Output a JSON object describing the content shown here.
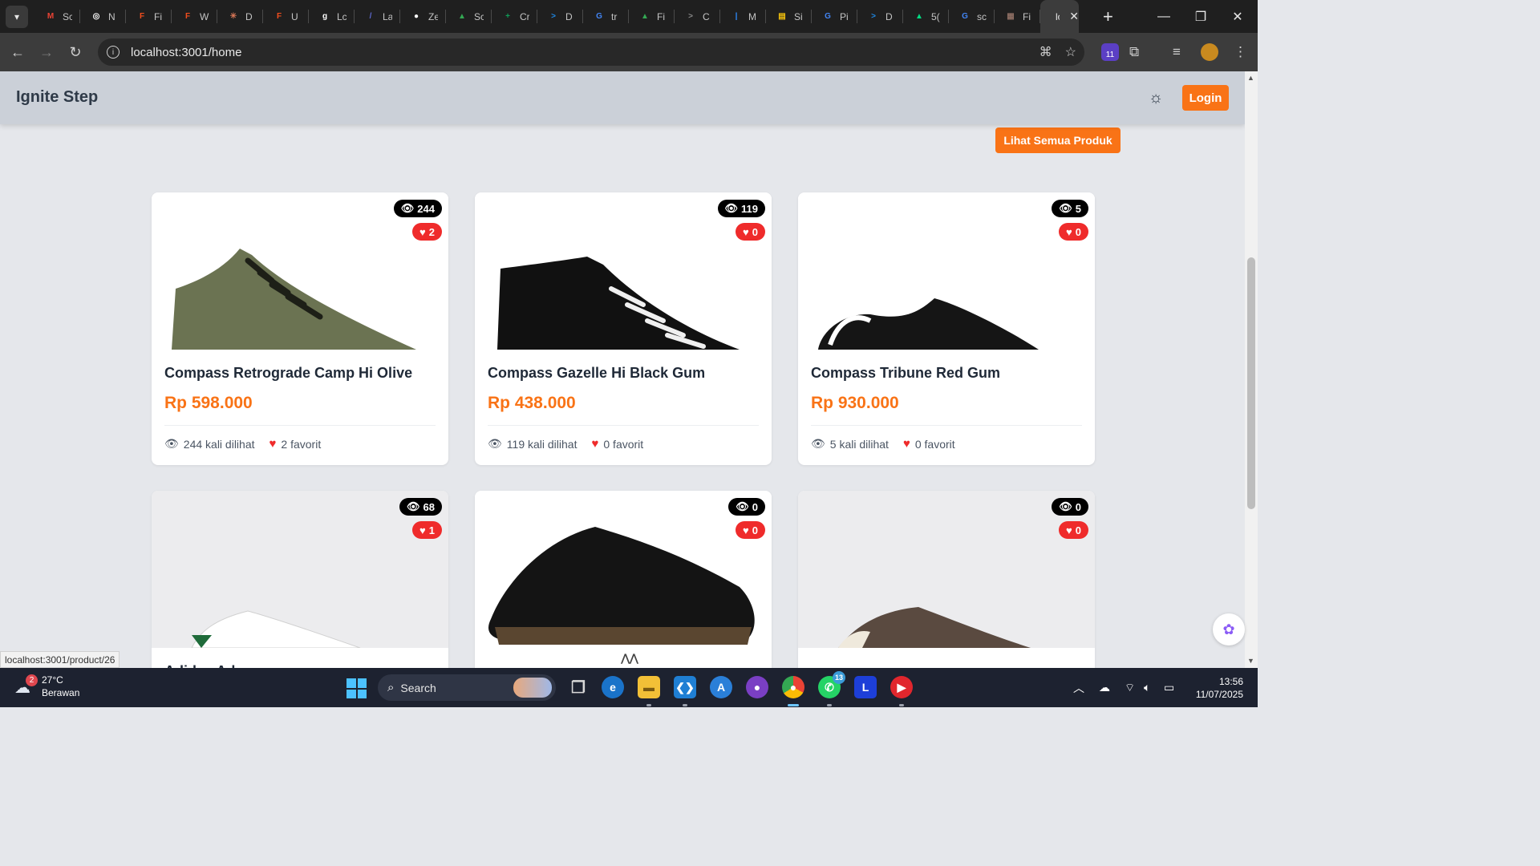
{
  "browser": {
    "tabs": [
      {
        "label": "Sc",
        "favicon": "gmail-icon",
        "color": "#ea4335",
        "glyph": "M"
      },
      {
        "label": "N",
        "favicon": "openai-icon",
        "color": "#ffffff",
        "glyph": "◎"
      },
      {
        "label": "Fi",
        "favicon": "figma-icon",
        "color": "#f24e1e",
        "glyph": "F"
      },
      {
        "label": "W",
        "favicon": "figma-icon",
        "color": "#f24e1e",
        "glyph": "F"
      },
      {
        "label": "D",
        "favicon": "claude-icon",
        "color": "#d97757",
        "glyph": "✳"
      },
      {
        "label": "U",
        "favicon": "figma-icon",
        "color": "#f24e1e",
        "glyph": "F"
      },
      {
        "label": "Lc",
        "favicon": "g-letter-icon",
        "color": "#ffffff",
        "glyph": "g"
      },
      {
        "label": "La",
        "favicon": "linear-icon",
        "color": "#5e6ad2",
        "glyph": "/"
      },
      {
        "label": "Ze",
        "favicon": "github-icon",
        "color": "#ffffff",
        "glyph": "●"
      },
      {
        "label": "Sc",
        "favicon": "google-drive-icon",
        "color": "#34a853",
        "glyph": "▲"
      },
      {
        "label": "Cr",
        "favicon": "google-sheets-icon",
        "color": "#0f9d58",
        "glyph": "+"
      },
      {
        "label": "D",
        "favicon": "terminal-icon",
        "color": "#1e88e5",
        "glyph": ">"
      },
      {
        "label": "tr",
        "favicon": "google-icon",
        "color": "#4285f4",
        "glyph": "G"
      },
      {
        "label": "Fi",
        "favicon": "google-drive-icon",
        "color": "#34a853",
        "glyph": "▲"
      },
      {
        "label": "C",
        "favicon": "terminal-icon",
        "color": "#888888",
        "glyph": ">"
      },
      {
        "label": "M",
        "favicon": "chart-icon",
        "color": "#2d8cff",
        "glyph": "|"
      },
      {
        "label": "Si",
        "favicon": "doc-icon",
        "color": "#f4c20d",
        "glyph": "▤"
      },
      {
        "label": "Pi",
        "favicon": "google-icon",
        "color": "#4285f4",
        "glyph": "G"
      },
      {
        "label": "D",
        "favicon": "terminal-icon",
        "color": "#1e88e5",
        "glyph": ">"
      },
      {
        "label": "5(",
        "favicon": "nuxt-icon",
        "color": "#00dc82",
        "glyph": "▲"
      },
      {
        "label": "sc",
        "favicon": "google-icon",
        "color": "#4285f4",
        "glyph": "G"
      },
      {
        "label": "Fi",
        "favicon": "image-icon",
        "color": "#8d6e63",
        "glyph": "▦"
      }
    ],
    "active_tab": {
      "label": "lo"
    },
    "url": "localhost:3001/home"
  },
  "page": {
    "brand": "Ignite Step",
    "login_label": "Login",
    "see_all_label": "Lihat Semua Produk",
    "status_url": "localhost:3001/product/26",
    "products": [
      {
        "name": "Compass Retrograde Camp Hi Olive",
        "price": "Rp 598.000",
        "views": "244",
        "favorites": "2",
        "views_text": "244 kali dilihat",
        "favorites_text": "2 favorit",
        "shoe_color": "#6b7352",
        "image_bg": "white"
      },
      {
        "name": "Compass Gazelle Hi Black Gum",
        "price": "Rp 438.000",
        "views": "119",
        "favorites": "0",
        "views_text": "119 kali dilihat",
        "favorites_text": "0 favorit",
        "shoe_color": "#111111",
        "image_bg": "white"
      },
      {
        "name": "Compass Tribune Red Gum",
        "price": "Rp 930.000",
        "views": "5",
        "favorites": "0",
        "views_text": "5 kali dilihat",
        "favorites_text": "0 favorit",
        "shoe_color": "#151515",
        "image_bg": "white"
      },
      {
        "name": "Adidas Advan...",
        "price": "",
        "views": "68",
        "favorites": "1",
        "views_text": "",
        "favorites_text": "",
        "shoe_color": "#f5f5f5",
        "image_bg": "gray"
      },
      {
        "name": "",
        "price": "",
        "views": "0",
        "favorites": "0",
        "views_text": "",
        "favorites_text": "",
        "shoe_color": "#141414",
        "image_bg": "white"
      },
      {
        "name": "",
        "price": "",
        "views": "0",
        "favorites": "0",
        "views_text": "",
        "favorites_text": "",
        "shoe_color": "#5a4a40",
        "image_bg": "gray"
      }
    ]
  },
  "taskbar": {
    "weather_temp": "27°C",
    "weather_desc": "Berawan",
    "weather_badge": "2",
    "search_label": "Search",
    "whatsapp_badge": "13",
    "time": "13:56",
    "date": "11/07/2025"
  },
  "colors": {
    "accent": "#f97316",
    "favorite_red": "#ef2b2b",
    "header_bg": "#cbd0d8",
    "page_bg": "#e5e7eb"
  }
}
